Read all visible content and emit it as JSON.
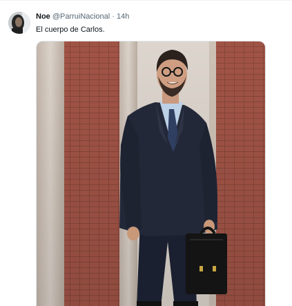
{
  "tweet": {
    "author_name": "Noe",
    "author_handle": "@ParruiNacional",
    "separator": "·",
    "timestamp": "14h",
    "text": "El cuerpo de Carlos."
  },
  "colors": {
    "text_primary": "#0f1419",
    "text_secondary": "#536471",
    "divider": "#eff3f4"
  }
}
